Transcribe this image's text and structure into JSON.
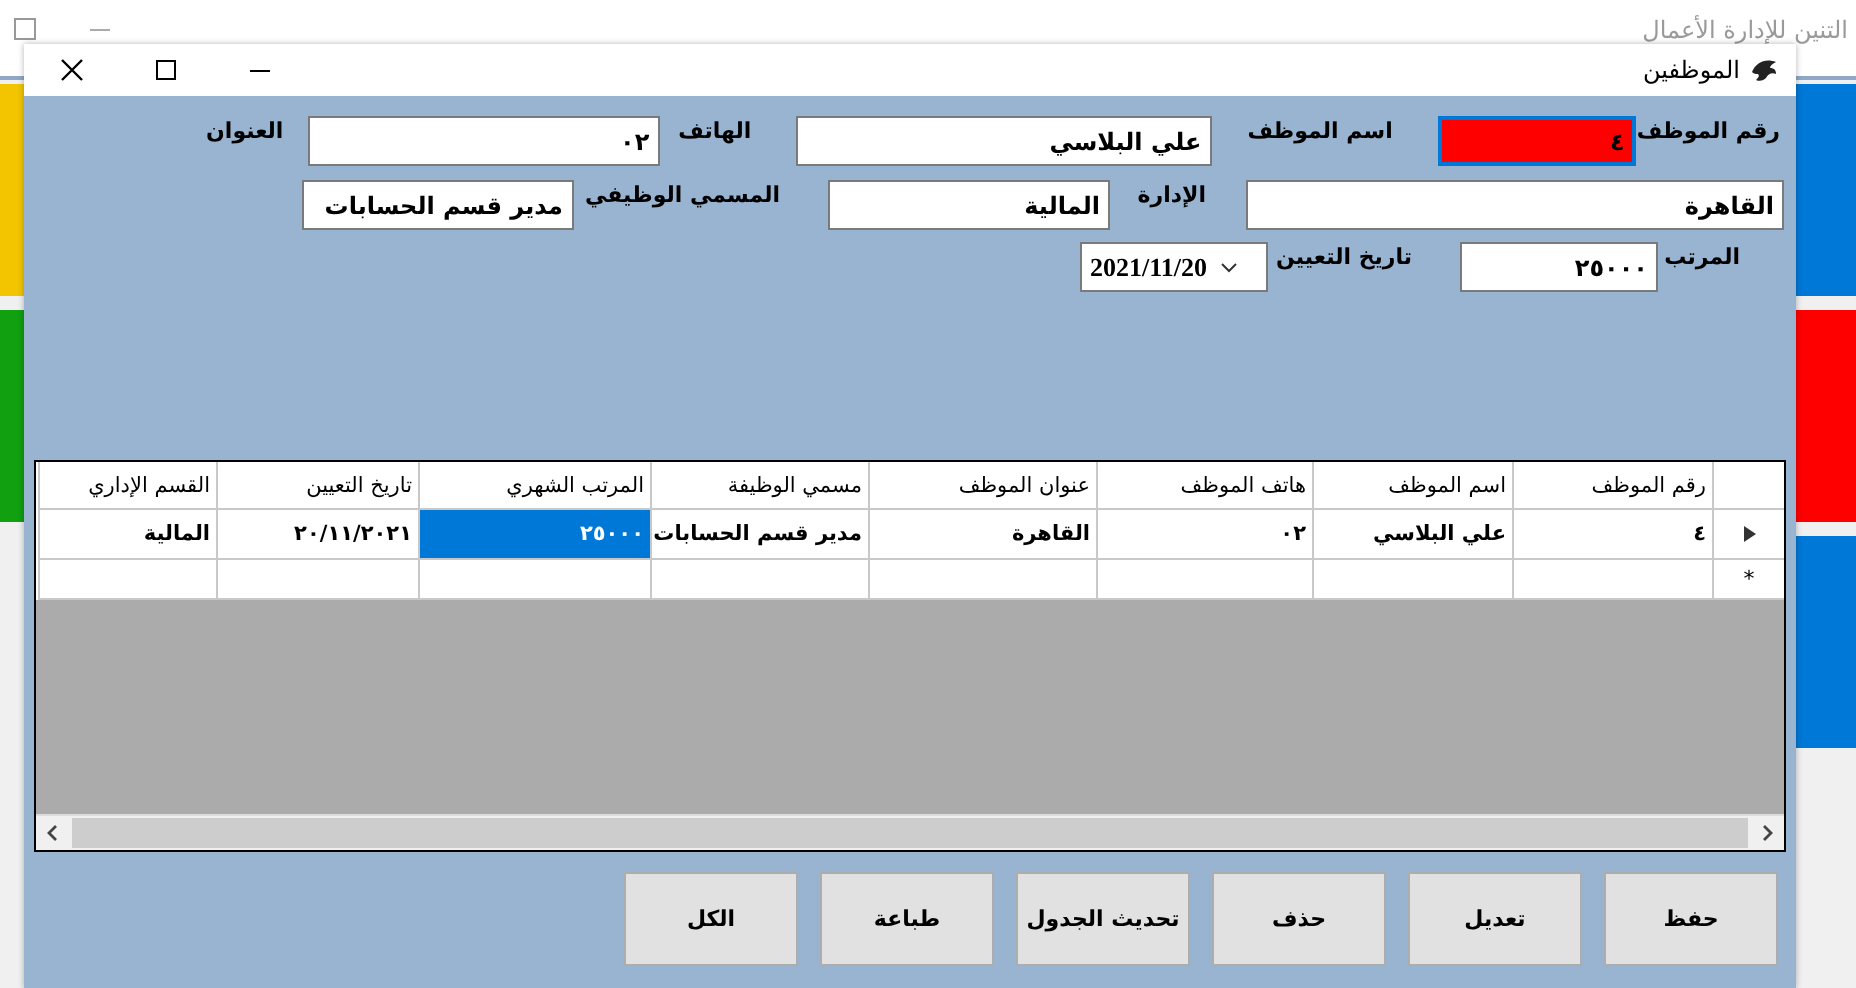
{
  "app_window": {
    "title": "التنين للإدارة الأعمال",
    "left_tiles": [
      {
        "color": "#f2c500"
      },
      {
        "color": "#10a010"
      }
    ],
    "right_tiles": [
      {
        "color": "#0078d7"
      },
      {
        "color": "#ff0000"
      },
      {
        "color": "#0078d7"
      }
    ]
  },
  "window": {
    "title": "الموظفين"
  },
  "form": {
    "line_1": [
      {
        "kind": "label",
        "text": "رقم الموظف"
      },
      {
        "kind": "field",
        "value": "٤",
        "highlighted": true
      },
      {
        "kind": "label",
        "text": "اسم الموظف"
      },
      {
        "kind": "field",
        "value": "علي البلاسي",
        "highlighted": false
      },
      {
        "kind": "label",
        "text": "الهاتف"
      },
      {
        "kind": "field",
        "value": "٠٢",
        "highlighted": false
      },
      {
        "kind": "label",
        "text": "العنوان"
      }
    ],
    "line_2": [
      {
        "kind": "field",
        "value": "القاهرة",
        "highlighted": false
      },
      {
        "kind": "label",
        "text": "الإدارة"
      },
      {
        "kind": "field",
        "value": "المالية",
        "highlighted": false
      },
      {
        "kind": "label",
        "text": "المسمي الوظيفي"
      },
      {
        "kind": "field",
        "value": "مدير قسم الحسابات",
        "highlighted": false
      }
    ],
    "line_3": [
      {
        "kind": "label",
        "text": "المرتب"
      },
      {
        "kind": "field",
        "value": "٢٥٠٠٠",
        "highlighted": false
      },
      {
        "kind": "label",
        "text": "تاريخ التعيين"
      },
      {
        "kind": "date",
        "value": "2021/11/20"
      }
    ]
  },
  "table": {
    "columns": [
      "رقم الموظف",
      "اسم الموظف",
      "هاتف الموظف",
      "عنوان الموظف",
      "مسمي الوظيفة",
      "المرتب الشهري",
      "تاريخ التعيين",
      "القسم الإداري"
    ],
    "rows": [
      {
        "current": true,
        "cells": [
          {
            "text": "٤",
            "selected": false
          },
          {
            "text": "علي البلاسي",
            "selected": false
          },
          {
            "text": "٠٢",
            "selected": false
          },
          {
            "text": "القاهرة",
            "selected": false
          },
          {
            "text": "مدير قسم الحسابات",
            "selected": false
          },
          {
            "text": "٢٥٠٠٠",
            "selected": true
          },
          {
            "text": "٢٠/١١/٢٠٢١",
            "selected": false
          },
          {
            "text": "المالية",
            "selected": false
          }
        ]
      }
    ],
    "new_row_marker": "*"
  },
  "buttons": [
    "حفظ",
    "تعديل",
    "حذف",
    "تحديث الجدول",
    "طباعة",
    "الكل"
  ]
}
